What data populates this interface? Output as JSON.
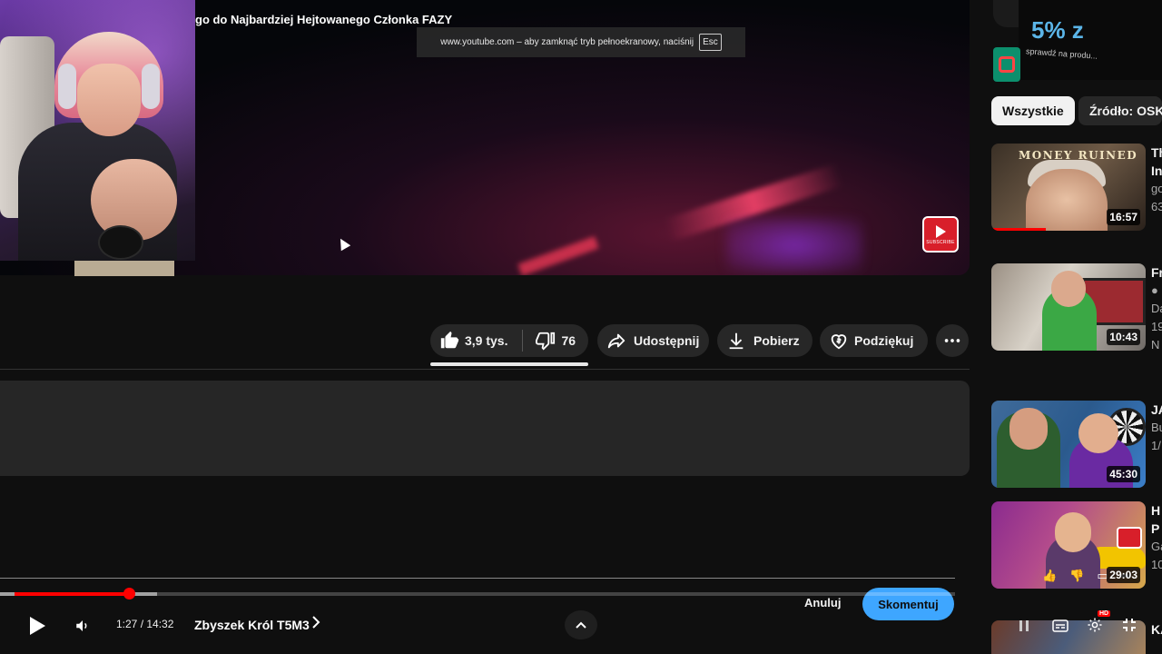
{
  "video": {
    "title_fragment": "go do Najbardziej Hejtowanego Członka FAZY",
    "subscribe_logo_text": "SUBSCRIBE"
  },
  "fullscreen_notice": {
    "text": "www.youtube.com – aby zamknąć tryb pełnoekranowy, naciśnij",
    "key": "Esc"
  },
  "actions": {
    "likes": "3,9 tys.",
    "dislikes": "76",
    "share": "Udostępnij",
    "download": "Pobierz",
    "thanks": "Podziękuj",
    "more_icon": "more-dots-icon"
  },
  "player": {
    "progress_fraction": 0.094,
    "time": "1:27 / 14:32",
    "chapter": "Zbyszek Król T5M3",
    "chapter_arrow": ">",
    "up_arrow": "^",
    "hd_badge": "HD"
  },
  "comment_box": {
    "cancel": "Anuluj",
    "submit": "Skomentuj"
  },
  "sidebar": {
    "ad": {
      "headline": "5% z",
      "sub": "sprawdź na produ..."
    },
    "chips": [
      "Wszystkie",
      "Źródło: OSKI"
    ],
    "videos": [
      {
        "thumb_title": "MONEY RUINED",
        "duration": "16:57",
        "meta": [
          "Th",
          "In",
          "go",
          "63"
        ]
      },
      {
        "duration": "10:43",
        "meta": [
          "Fr",
          "●",
          "Da",
          "19",
          "N"
        ]
      },
      {
        "duration": "45:30",
        "meta": [
          "JA",
          "Bu",
          "1/"
        ]
      },
      {
        "duration": "29:03",
        "meta": [
          "H",
          "P",
          "Ga",
          "10"
        ]
      },
      {
        "meta": [
          "KA"
        ]
      }
    ]
  },
  "colors": {
    "accent_red": "#ff0000",
    "comment_blue": "#3ea6ff",
    "chip_bg": "#272727"
  }
}
